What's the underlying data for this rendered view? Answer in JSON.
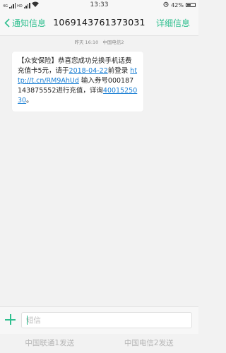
{
  "status_bar": {
    "signal1_label": "4G",
    "signal2_label": "HD",
    "time": "13:33",
    "battery": "42%",
    "battery_level": 0.42
  },
  "header": {
    "back_label": "通知信息",
    "title": "1069143761373031",
    "detail_label": "详细信息"
  },
  "meta": {
    "time": "昨天 16:10",
    "carrier": "中国电信2"
  },
  "message": {
    "part1": "【众安保险】恭喜您成功兑换手机话费充值卡5元，请于",
    "date_link": "2018-04-22",
    "part2": "前登录 ",
    "url_link": "http://t.cn/RM9AhUd",
    "part3": " 输入券号000187143875552进行充值，详询",
    "phone_link": "4001525030",
    "part4": "。"
  },
  "input": {
    "placeholder": "短信",
    "value": ""
  },
  "send_buttons": {
    "unicom": "中国联通1发送",
    "telecom": "中国电信2发送"
  },
  "colors": {
    "accent": "#2fbf8f",
    "link": "#1a7fd4",
    "background": "#f2f2f2"
  }
}
